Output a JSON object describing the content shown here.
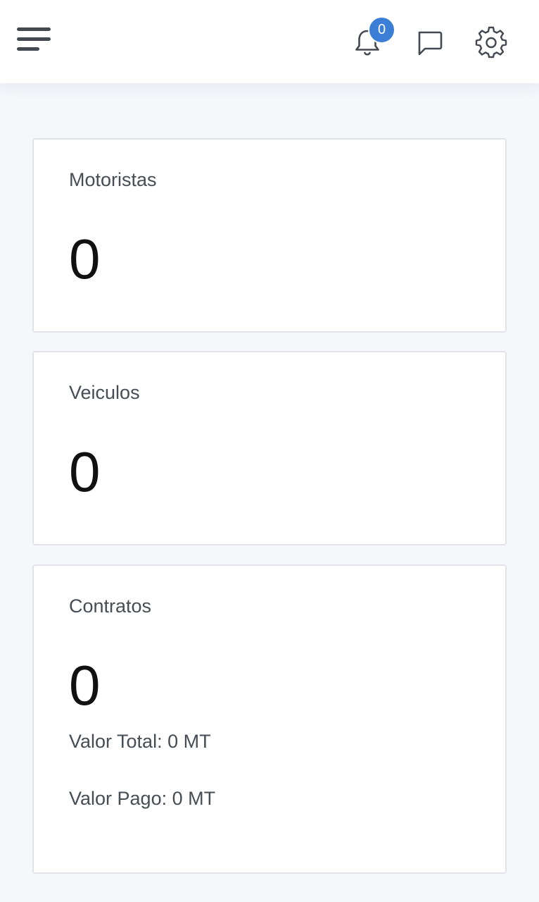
{
  "header": {
    "menu_icon": "hamburger-menu-icon",
    "notifications_icon": "bell-icon",
    "notifications_count": "0",
    "messages_icon": "chat-bubble-icon",
    "settings_icon": "gear-icon"
  },
  "cards": [
    {
      "title": "Motoristas",
      "value": "0"
    },
    {
      "title": "Veiculos",
      "value": "0"
    },
    {
      "title": "Contratos",
      "value": "0",
      "valor_total": "Valor Total: 0 MT",
      "valor_pago": "Valor Pago: 0 MT"
    }
  ],
  "colors": {
    "accent": "#3a7fd5",
    "background": "#f6f7fb",
    "card_border": "#e1e3e8",
    "icon": "#434851"
  }
}
